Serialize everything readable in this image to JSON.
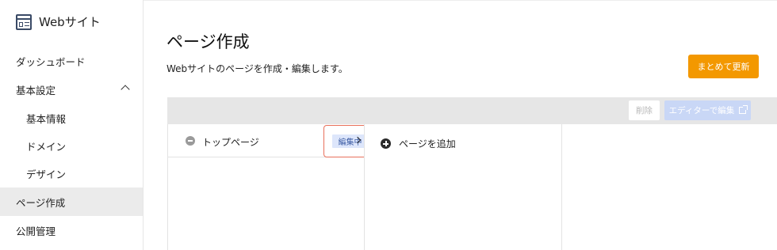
{
  "sidebar": {
    "brand_label": "Webサイト",
    "brand_icon": "website-icon",
    "items": [
      {
        "label": "ダッシュボード"
      },
      {
        "label": "基本設定"
      },
      {
        "label": "基本情報"
      },
      {
        "label": "ドメイン"
      },
      {
        "label": "デザイン"
      },
      {
        "label": "ページ作成"
      },
      {
        "label": "公開管理"
      }
    ]
  },
  "main": {
    "title": "ページ作成",
    "description": "Webサイトのページを作成・編集します。",
    "update_button": "まとめて更新",
    "toolbar": {
      "delete_button": "削除",
      "editor_button": "エディターで編集"
    },
    "tree": {
      "page_name": "トップページ",
      "badge": "編集中",
      "add_page": "ページを追加"
    }
  },
  "colors": {
    "accent_orange": "#f39800",
    "editor_button_disabled": "#c9d7f6",
    "badge_bg": "#dde6fb",
    "highlight_border": "#e8705b"
  }
}
